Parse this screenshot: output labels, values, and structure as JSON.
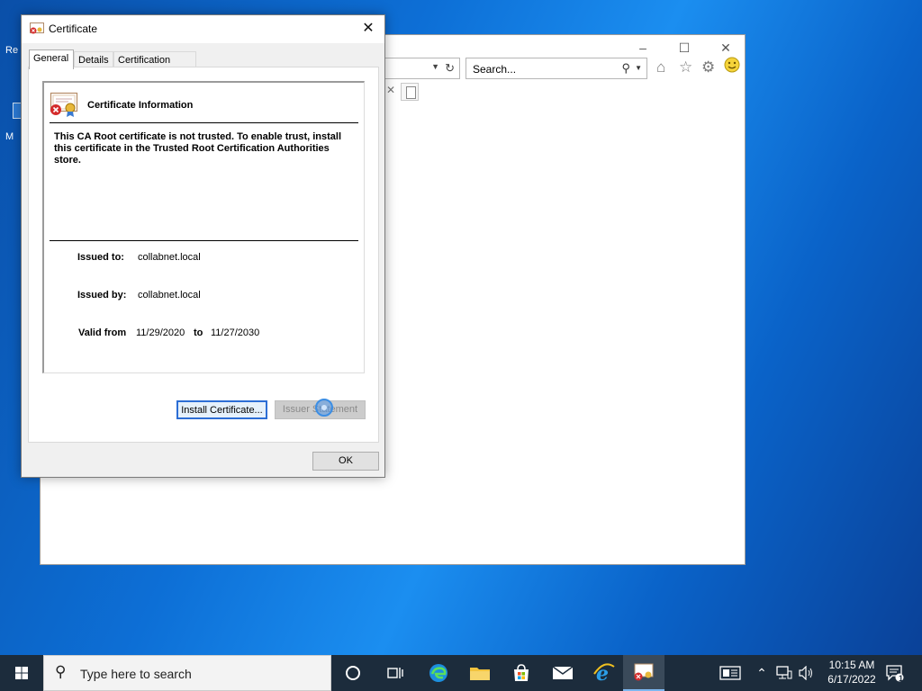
{
  "desktop": {
    "icon_labels": [
      "Re",
      "M"
    ]
  },
  "ie": {
    "search_placeholder": "Search..."
  },
  "dialog": {
    "title": "Certificate",
    "tabs": [
      "General",
      "Details",
      "Certification Path"
    ],
    "active_tab": "General",
    "cert_info_title": "Certificate Information",
    "warning_text": "This CA Root certificate is not trusted. To enable trust, install this certificate in the Trusted Root Certification Authorities store.",
    "issued_to_label": "Issued to:",
    "issued_to_value": "collabnet.local",
    "issued_by_label": "Issued by:",
    "issued_by_value": "collabnet.local",
    "valid_from_label": "Valid from",
    "valid_from_value": "11/29/2020",
    "valid_to_label": "to",
    "valid_to_value": "11/27/2030",
    "install_button": "Install Certificate...",
    "issuer_button": "Issuer Statement",
    "ok_button": "OK"
  },
  "taskbar": {
    "search_placeholder": "Type here to search",
    "time": "10:15 AM",
    "date": "6/17/2022",
    "notification_count": "1"
  }
}
